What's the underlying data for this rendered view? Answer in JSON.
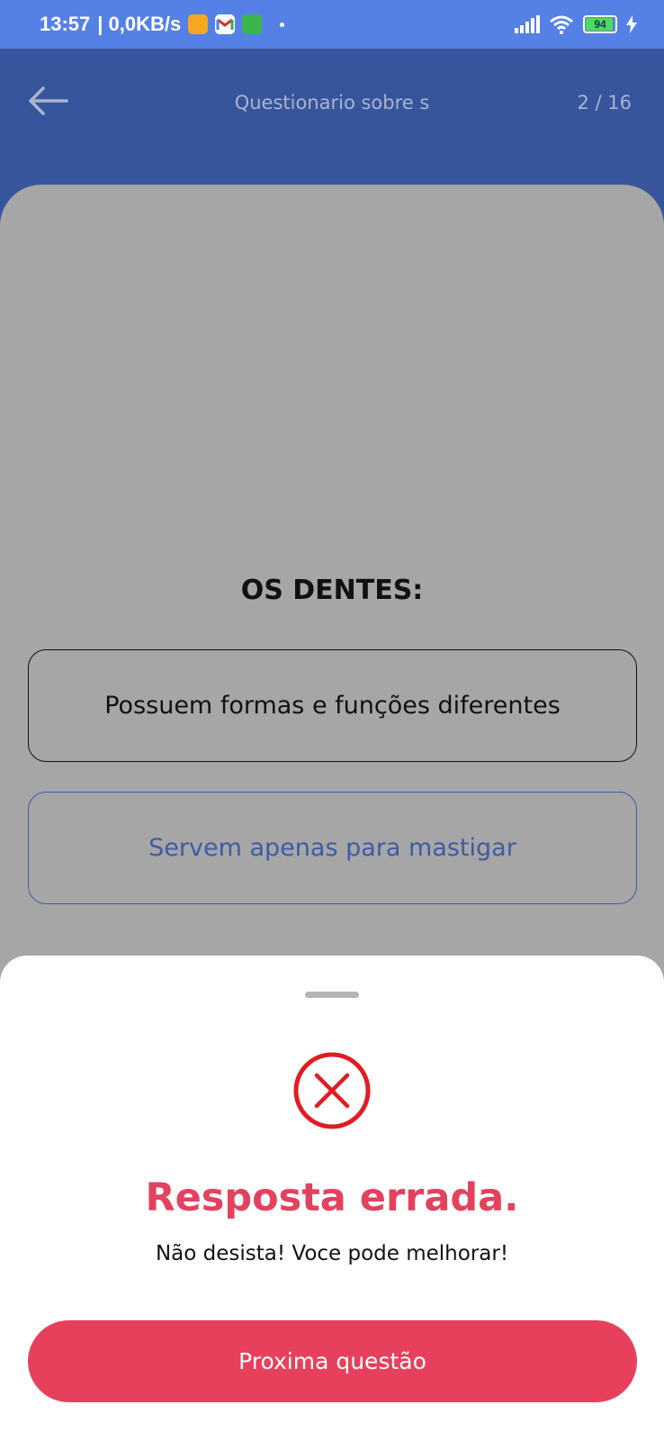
{
  "status_bar": {
    "time": "13:57",
    "net_speed": "| 0,0KB/s",
    "battery_level": "94",
    "icons": [
      "files-icon",
      "gmail-icon",
      "app-icon",
      "signal-icon",
      "wifi-icon",
      "battery-icon",
      "charging-icon"
    ]
  },
  "header": {
    "title": "Questionario sobre s",
    "progress": "2 / 16",
    "back_icon": "arrow-left-icon"
  },
  "quiz": {
    "question": "OS DENTES:",
    "options": [
      {
        "label": "Possuem formas e funções diferentes"
      },
      {
        "label": "Servem apenas para mastigar"
      }
    ]
  },
  "result_sheet": {
    "icon": "x-circle-icon",
    "title": "Resposta errada.",
    "subtitle": "Não desista! Voce pode melhorar!",
    "button_label": "Proxima questão"
  },
  "colors": {
    "status_bar": "#5581e6",
    "header": "#37559c",
    "overlay": "#a6a6a6",
    "error": "#e3425e",
    "button": "#e7405c",
    "option_selected": "#3e5ba5"
  }
}
